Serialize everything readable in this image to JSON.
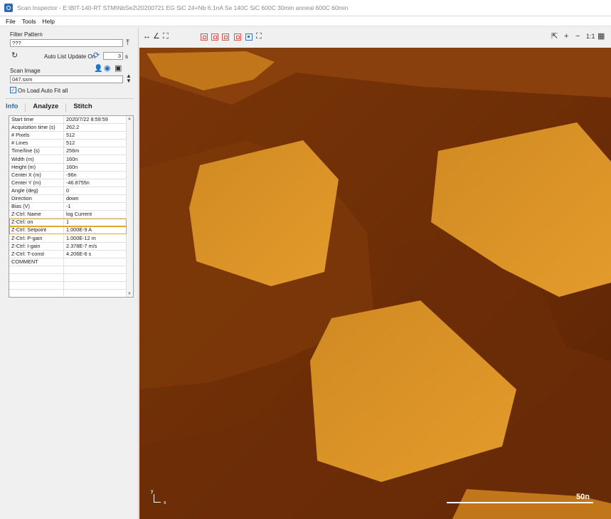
{
  "window": {
    "title": "Scan Inspector - E:\\BIT-140-RT STM\\NbSe2\\20200721 EG SiC 24+Nb 6.1nA Se 140C SiC 600C 30min anneal 600C 60min"
  },
  "menu": [
    "File",
    "Tools",
    "Help"
  ],
  "sidebar": {
    "filter_label": "Filter Pattern",
    "filter_value": "???",
    "auto_update_label": "Auto List Update On",
    "auto_update_seconds": "3",
    "seconds_unit": "s",
    "scan_image_label": "Scan Image",
    "scan_image_value": "047.sxm",
    "autofit_label": "On Load Auto Fit all"
  },
  "tabs": [
    "Info",
    "Analyze",
    "Stitch"
  ],
  "properties": [
    {
      "key": "Start time",
      "value": "2020/7/22 8:59:59"
    },
    {
      "key": "Acquisition time (s)",
      "value": "262.2"
    },
    {
      "key": "# Pixels",
      "value": "512"
    },
    {
      "key": "# Lines",
      "value": "512"
    },
    {
      "key": "Time/line (s)",
      "value": "256m"
    },
    {
      "key": "Width (m)",
      "value": "160n"
    },
    {
      "key": "Height (m)",
      "value": "160n"
    },
    {
      "key": "Center X (m)",
      "value": "-96n"
    },
    {
      "key": "Center Y (m)",
      "value": "-46.8755n"
    },
    {
      "key": "Angle (deg)",
      "value": "0"
    },
    {
      "key": "Direction",
      "value": "down"
    },
    {
      "key": "Bias (V)",
      "value": "-1"
    },
    {
      "key": "Z-Ctrl: Name",
      "value": "log Current"
    },
    {
      "key": "Z-Ctrl: on",
      "value": "1"
    },
    {
      "key": "Z-Ctrl: Setpoint",
      "value": "1.000E-9 A"
    },
    {
      "key": "Z-Ctrl: P-gain",
      "value": "1.000E-12 m"
    },
    {
      "key": "Z-Ctrl: I-gain",
      "value": "2.378E-7 m/s"
    },
    {
      "key": "Z-Ctrl: T-const",
      "value": "4.206E-6 s"
    },
    {
      "key": "COMMENT",
      "value": ""
    },
    {
      "key": "",
      "value": ""
    },
    {
      "key": "",
      "value": ""
    },
    {
      "key": "",
      "value": ""
    },
    {
      "key": "",
      "value": ""
    }
  ],
  "toolbar": {
    "zoom_label": "1:1"
  },
  "image": {
    "scalebar_label": "50n",
    "axis_y": "y",
    "axis_x": "x"
  },
  "colors": {
    "accent": "#2a6bb5",
    "highlight": "#e5a72a",
    "substrate_dark": "#5a2305",
    "terrace_mid": "#8a3f0b",
    "island": "#d88d1f"
  }
}
